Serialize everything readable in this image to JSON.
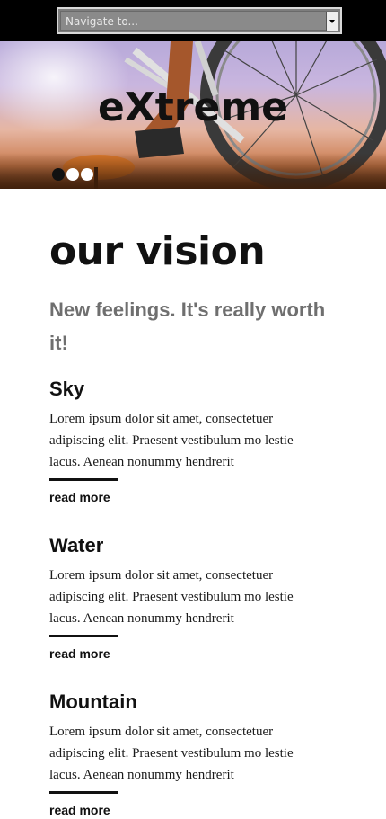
{
  "nav": {
    "select_label": "Navigate to..."
  },
  "hero": {
    "title": "eXtreme",
    "slides": [
      {
        "active": true
      },
      {
        "active": false
      },
      {
        "active": false
      }
    ]
  },
  "main": {
    "heading": "our vision",
    "subtitle": "New feelings. It's really worth it!",
    "sections": [
      {
        "title": "Sky",
        "body": "Lorem ipsum dolor sit amet, consectetuer adipiscing elit. Praesent vestibulum mo lestie lacus. Aenean nonummy hendrerit",
        "link": "read more"
      },
      {
        "title": "Water",
        "body": "Lorem ipsum dolor sit amet, consectetuer adipiscing elit. Praesent vestibulum mo lestie lacus. Aenean nonummy hendrerit",
        "link": "read more"
      },
      {
        "title": "Mountain",
        "body": "Lorem ipsum dolor sit amet, consectetuer adipiscing elit. Praesent vestibulum mo lestie lacus. Aenean nonummy hendrerit",
        "link": "read more"
      }
    ]
  }
}
